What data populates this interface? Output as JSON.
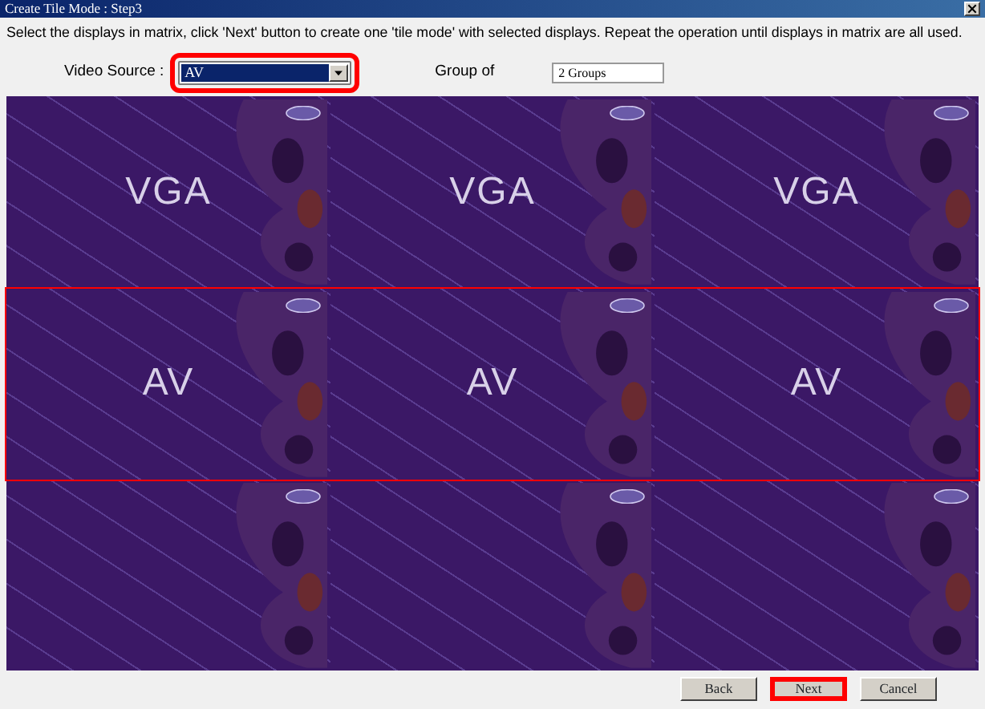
{
  "window": {
    "title": "Create Tile Mode : Step3"
  },
  "instruction": "Select the displays in matrix, click 'Next' button to create one 'tile mode' with selected displays. Repeat the operation until displays in matrix are all used.",
  "video_source": {
    "label": "Video Source :",
    "value": "AV",
    "highlighted": true
  },
  "group_of": {
    "label": "Group of",
    "value": "2 Groups"
  },
  "matrix": [
    {
      "selected": false,
      "tiles": [
        {
          "kind": "labeled",
          "label": "VGA"
        },
        {
          "kind": "labeled",
          "label": "VGA"
        },
        {
          "kind": "labeled",
          "label": "VGA"
        }
      ]
    },
    {
      "selected": true,
      "tiles": [
        {
          "kind": "labeled",
          "label": "AV"
        },
        {
          "kind": "labeled",
          "label": "AV"
        },
        {
          "kind": "labeled",
          "label": "AV"
        }
      ]
    },
    {
      "selected": false,
      "tiles": [
        {
          "kind": "blank"
        },
        {
          "kind": "blank"
        },
        {
          "kind": "blank"
        }
      ]
    }
  ],
  "buttons": [
    {
      "label": "Back",
      "highlighted": false
    },
    {
      "label": "Next",
      "highlighted": true
    },
    {
      "label": "Cancel",
      "highlighted": false
    }
  ]
}
